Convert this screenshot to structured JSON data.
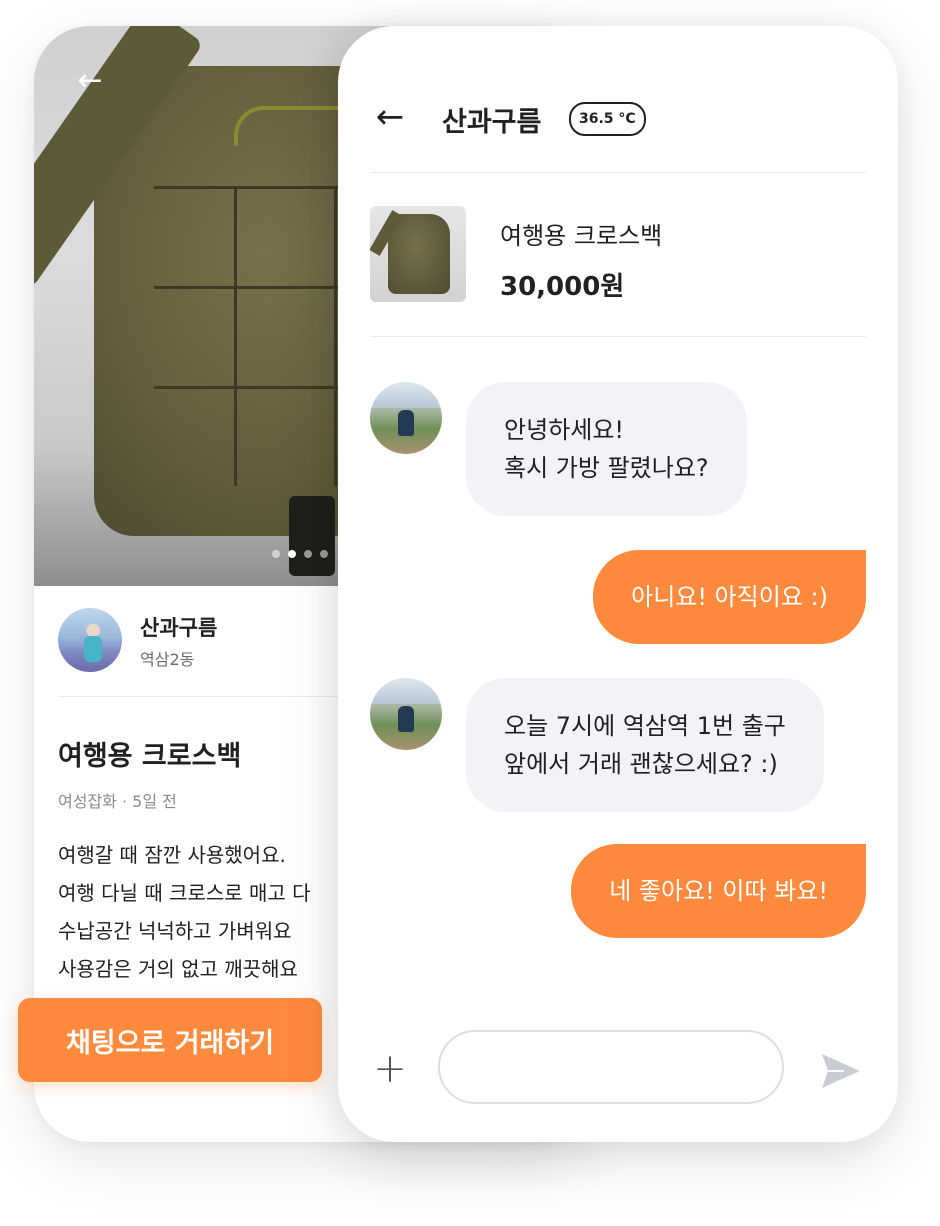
{
  "product_screen": {
    "back_icon": "arrow-left-icon",
    "photo_alt": "travel-crossbag-photo",
    "photo_dots": [
      {
        "active": false
      },
      {
        "active": true
      },
      {
        "active": false
      },
      {
        "active": false
      }
    ],
    "seller": {
      "name": "산과구름",
      "location": "역삼2동"
    },
    "title": "여행용 크로스백",
    "meta": "여성잡화 · 5일 전",
    "description_lines": [
      "여행갈 때 잠깐 사용했어요.",
      "여행 다닐 때 크로스로 매고 다",
      "수납공간 넉넉하고 가벼워요",
      "사용감은 거의 없고 깨끗해요"
    ],
    "cta_label": "채팅으로 거래하기"
  },
  "chat_screen": {
    "back_icon": "arrow-left-icon",
    "partner_name": "산과구름",
    "temperature": "36.5 °C",
    "product": {
      "title": "여행용 크로스백",
      "price": "30,000원"
    },
    "messages": [
      {
        "from": "partner",
        "lines": [
          "안녕하세요!",
          "혹시 가방 팔렸나요?"
        ]
      },
      {
        "from": "me",
        "lines": [
          "아니요! 아직이요 :)"
        ]
      },
      {
        "from": "partner",
        "lines": [
          "오늘 7시에 역삼역 1번 출구",
          "앞에서 거래 괜찮으세요? :)"
        ]
      },
      {
        "from": "me",
        "lines": [
          "네 좋아요! 이따 봐요!"
        ]
      }
    ],
    "composer": {
      "plus_icon": "plus-icon",
      "input_value": "",
      "send_icon": "send-icon"
    }
  },
  "colors": {
    "accent": "#ff8a3d",
    "incoming_bubble": "#f2f3f6",
    "text": "#212124",
    "muted": "#868b94"
  }
}
